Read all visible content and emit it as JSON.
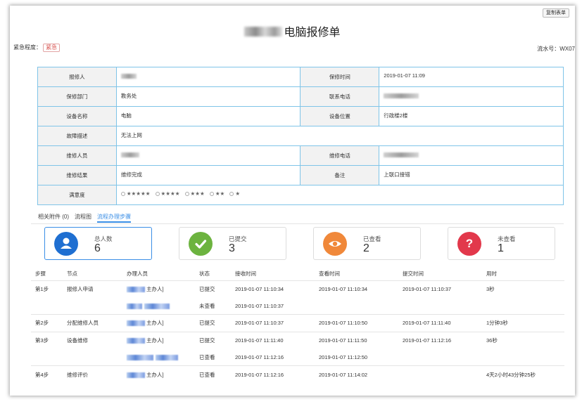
{
  "copy_button": "复制表单",
  "title": {
    "blurred_prefix": "",
    "text": "电脑报修单"
  },
  "urgency": {
    "label": "紧急程度：",
    "value": "紧急"
  },
  "serial": "流水号：WX07",
  "info": {
    "reporter_label": "报修人",
    "repair_time_label": "保修时间",
    "repair_time": "2019-01-07 11:09",
    "dept_label": "保修部门",
    "dept": "教务处",
    "phone_label": "联系电话",
    "device_name_label": "设备名称",
    "device_name": "电脑",
    "location_label": "设备位置",
    "location": "行政楼2楼",
    "fault_label": "故障描述",
    "fault": "无法上网",
    "repairer_label": "维修人员",
    "repairer_phone_label": "维修电话",
    "result_label": "维修结果",
    "result": "维修完成",
    "remark_label": "备注",
    "remark": "上联口接错",
    "satisfaction_label": "满意度",
    "satisfaction_options": [
      "★★★★★",
      "★★★★",
      "★★★",
      "★★",
      "★"
    ]
  },
  "tabs": [
    "相关附件 (0)",
    "流程图",
    "流程办理步骤"
  ],
  "cards": [
    {
      "label": "总人数",
      "value": "6",
      "icon": "user-icon",
      "color": "#1f6fd1"
    },
    {
      "label": "已提交",
      "value": "3",
      "icon": "check-icon",
      "color": "#6cb33f"
    },
    {
      "label": "已查看",
      "value": "2",
      "icon": "eye-icon",
      "color": "#f0883a"
    },
    {
      "label": "未查看",
      "value": "1",
      "icon": "question-icon",
      "color": "#e2384b"
    }
  ],
  "steps_table": {
    "headers": [
      "步骤",
      "节点",
      "办理人员",
      "状态",
      "接收时间",
      "查看时间",
      "提交时间",
      "用时"
    ],
    "rows": [
      {
        "step": "第1步",
        "node": "报修人申请",
        "handler_suffix": "主办人]",
        "status": "已提交",
        "status_type": "green",
        "received": "2019-01-07 11:10:34",
        "viewed": "2019-01-07 11:10:34",
        "submitted": "2019-01-07 11:10:37",
        "duration": "3秒",
        "group_start": true
      },
      {
        "step": "",
        "node": "",
        "handler_suffix": "",
        "status": "未查看",
        "status_type": "red",
        "received": "2019-01-07 11:10:37",
        "viewed": "",
        "submitted": "",
        "duration": "",
        "group_start": false
      },
      {
        "step": "第2步",
        "node": "分配维修人员",
        "handler_suffix": "主办人]",
        "status": "已提交",
        "status_type": "green",
        "received": "2019-01-07 11:10:37",
        "viewed": "2019-01-07 11:10:50",
        "submitted": "2019-01-07 11:11:40",
        "duration": "1分钟3秒",
        "group_start": true
      },
      {
        "step": "第3步",
        "node": "设备维修",
        "handler_suffix": "主办人]",
        "status": "已提交",
        "status_type": "green",
        "received": "2019-01-07 11:11:40",
        "viewed": "2019-01-07 11:11:50",
        "submitted": "2019-01-07 11:12:16",
        "duration": "36秒",
        "group_start": true
      },
      {
        "step": "",
        "node": "",
        "handler_suffix": "",
        "status": "已查看",
        "status_type": "gray",
        "received": "2019-01-07 11:12:16",
        "viewed": "2019-01-07 11:12:50",
        "submitted": "",
        "duration": "",
        "group_start": false
      },
      {
        "step": "第4步",
        "node": "维修评价",
        "handler_suffix": "主办人]",
        "status": "已查看",
        "status_type": "gray",
        "received": "2019-01-07 11:12:16",
        "viewed": "2019-01-07 11:14:02",
        "submitted": "",
        "duration": "4天2小时43分钟25秒",
        "group_start": true
      }
    ]
  }
}
